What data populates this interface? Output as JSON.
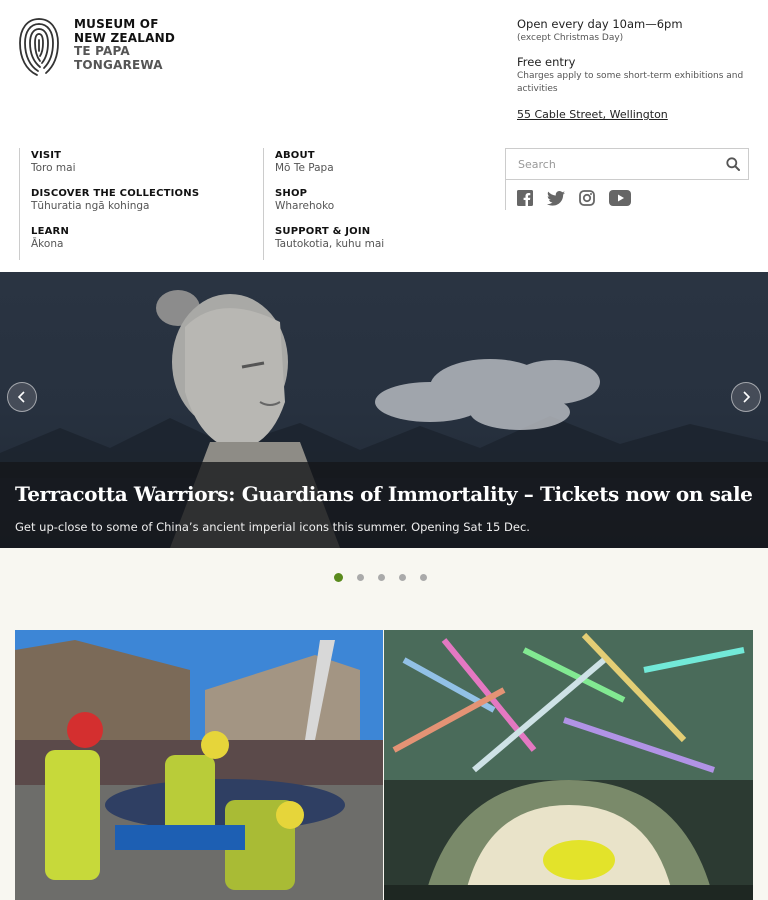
{
  "brand": {
    "line1": "MUSEUM OF",
    "line2": "NEW ZEALAND",
    "line3": "TE PAPA",
    "line4": "TONGAREWA"
  },
  "info": {
    "hours": "Open every day 10am—6pm",
    "hours_note": "(except Christmas Day)",
    "entry": "Free entry",
    "entry_note": "Charges apply to some short-term exhibitions and activities",
    "address": "55 Cable Street, Wellington"
  },
  "nav": {
    "col1": [
      {
        "title": "VISIT",
        "sub": "Toro mai"
      },
      {
        "title": "DISCOVER THE COLLECTIONS",
        "sub": "Tūhuratia ngā kohinga"
      },
      {
        "title": "LEARN",
        "sub": "Ākona"
      }
    ],
    "col2": [
      {
        "title": "ABOUT",
        "sub": "Mō Te Papa"
      },
      {
        "title": "SHOP",
        "sub": "Wharehoko"
      },
      {
        "title": "SUPPORT & JOIN",
        "sub": "Tautokotia, kuhu mai"
      }
    ]
  },
  "search": {
    "placeholder": "Search"
  },
  "socials": [
    "facebook-icon",
    "twitter-icon",
    "instagram-icon",
    "youtube-icon"
  ],
  "hero": {
    "title": "Terracotta Warriors: Guardians of Immortality – Tickets now on sale",
    "subtitle": "Get up-close to some of China’s ancient imperial icons this summer. Opening Sat 15 Dec."
  },
  "carousel": {
    "slides": 5,
    "active": 1
  },
  "colors": {
    "accent": "#5a8a1d",
    "lower_bg": "#f8f7f1"
  }
}
